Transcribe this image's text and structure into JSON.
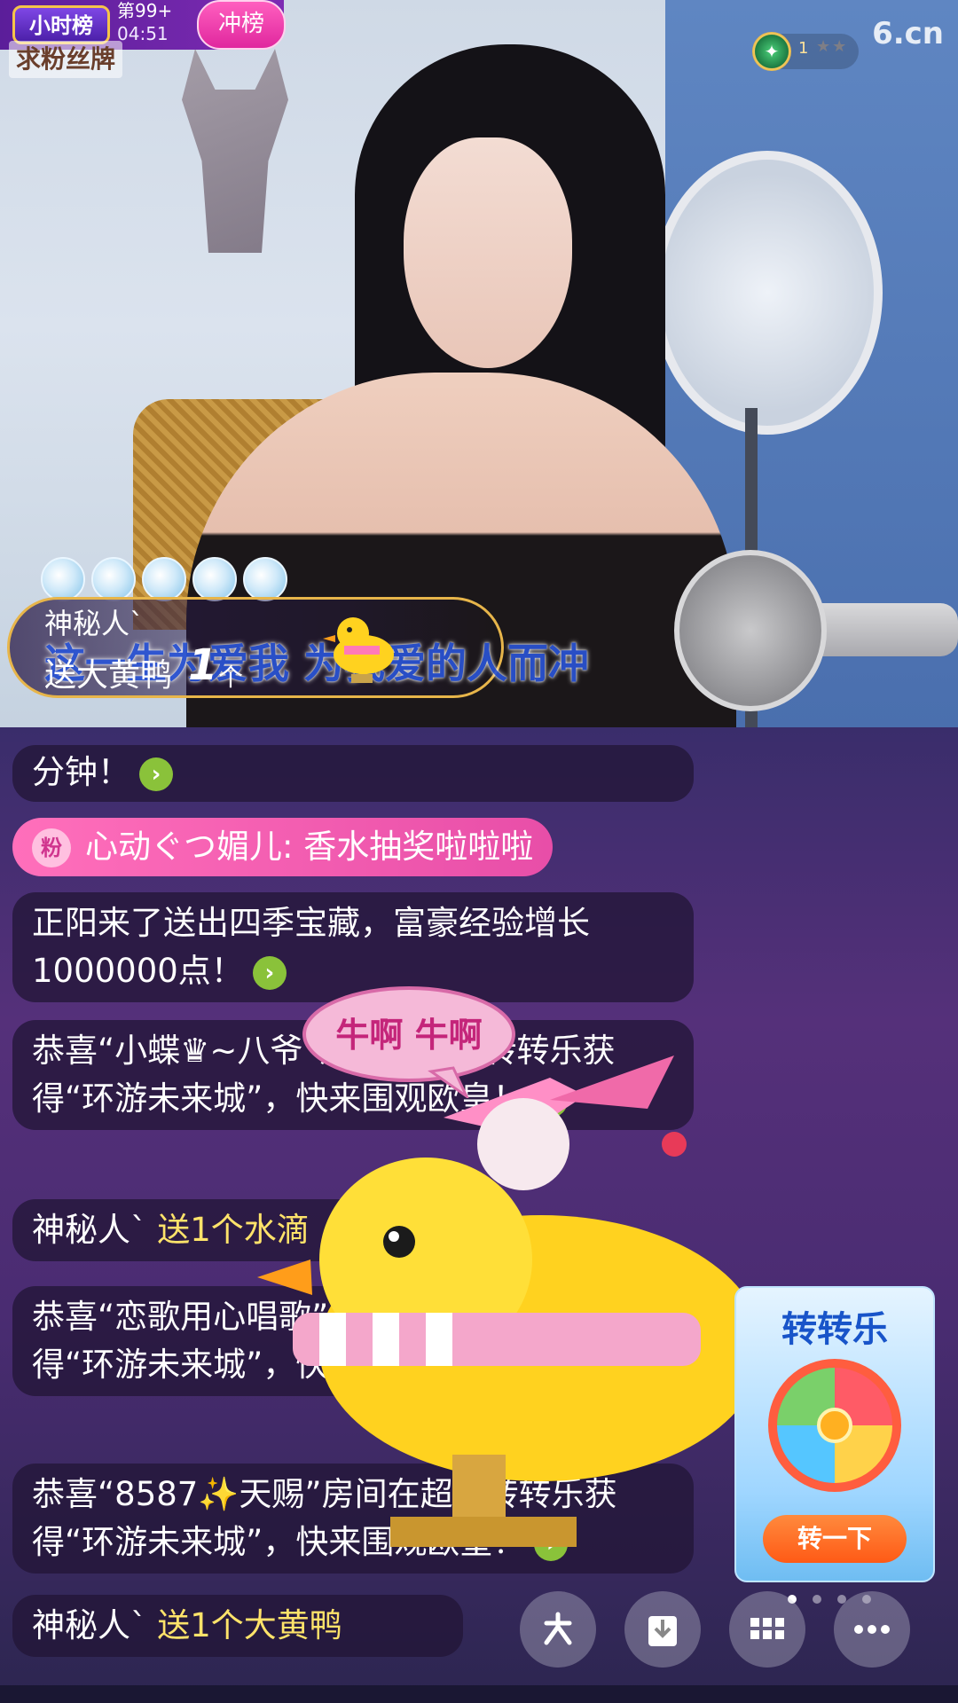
{
  "top": {
    "hour_rank_label": "小时榜",
    "rank_text": "第99+",
    "rank_time": "04:51",
    "chongbang_label": "冲榜",
    "fan_badge_text": "求粉丝牌",
    "watermark": "6.cn",
    "level_number": "1",
    "level_stars": "★★"
  },
  "gift_banner": {
    "user": "神秘人`",
    "send_text": "送大黄鸭",
    "count": "1",
    "unit": "个",
    "lyric": "这一生为爱我 为我爱的人而冲"
  },
  "chat": {
    "msg0_text": "分钟！",
    "fan_tag": "粉",
    "fan_message": "心动ぐつ媚儿: 香水抽奖啦啦啦",
    "msg1_text": "正阳来了送出四季宝藏，富豪经验增长1000000点！",
    "msg2_text": "恭喜“小蝶♛~八爷”房间在超级转转乐获得“环游未来城”，快来围观欧皇！",
    "msg3_user": "神秘人`",
    "msg3_text": "送1个水滴",
    "msg4_text": "恭喜“恋歌用心唱歌”房间在超级转转乐获得“环游未来城”，快来围观欧皇！",
    "msg5_text": "恭喜“8587✨天赐”房间在超级转转乐获得“环游未来城”，快来围观欧皇！",
    "msg6_user": "神秘人`",
    "msg6_text": "送1个大黄鸭",
    "speech_text": "牛啊 牛啊"
  },
  "promo": {
    "title": "转转乐",
    "button": "转一下"
  },
  "bottom_buttons": {
    "share_icon": "share-icon",
    "save_icon": "download-icon",
    "grid_icon": "grid-icon",
    "more_icon": "more-icon"
  }
}
